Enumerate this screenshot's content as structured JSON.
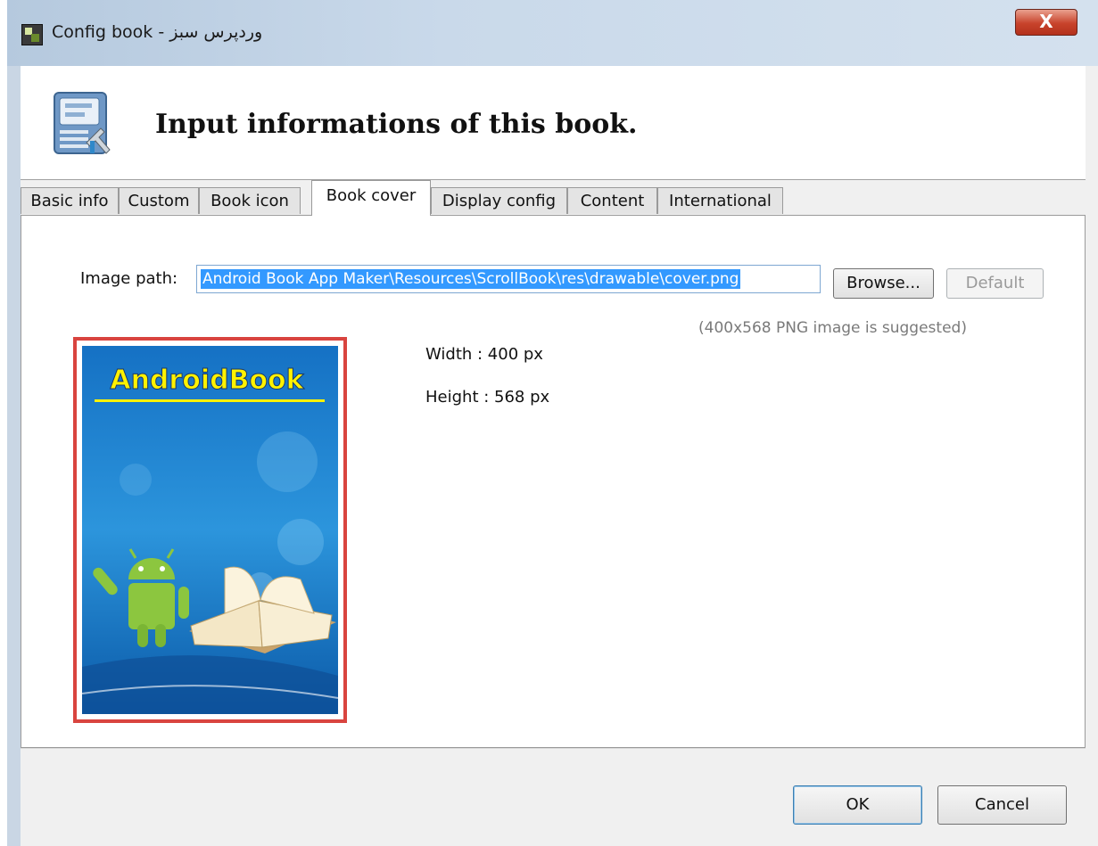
{
  "window": {
    "title": "Config book - وردپرس سبز",
    "close_glyph": "X",
    "app_icon": "book-app-icon"
  },
  "header": {
    "title": "Input informations of this book.",
    "icon": "book-settings-icon"
  },
  "tabs": [
    {
      "label": "Basic info",
      "active": false
    },
    {
      "label": "Custom",
      "active": false
    },
    {
      "label": "Book icon",
      "active": false
    },
    {
      "label": "Book cover",
      "active": true
    },
    {
      "label": "Display config",
      "active": false
    },
    {
      "label": "Content",
      "active": false
    },
    {
      "label": "International",
      "active": false
    }
  ],
  "cover": {
    "path_label": "Image path:",
    "path_value": "Android Book App Maker\\Resources\\ScrollBook\\res\\drawable\\cover.png",
    "browse_label": "Browse...",
    "default_label": "Default",
    "hint": "(400x568 PNG image is suggested)",
    "width_text": "Width : 400 px",
    "height_text": "Height : 568 px",
    "preview_title": "AndroidBook"
  },
  "footer": {
    "ok_label": "OK",
    "cancel_label": "Cancel"
  },
  "colors": {
    "cover_border": "#d9443f",
    "selection": "#3399ff",
    "close_button": "#c8432b"
  }
}
